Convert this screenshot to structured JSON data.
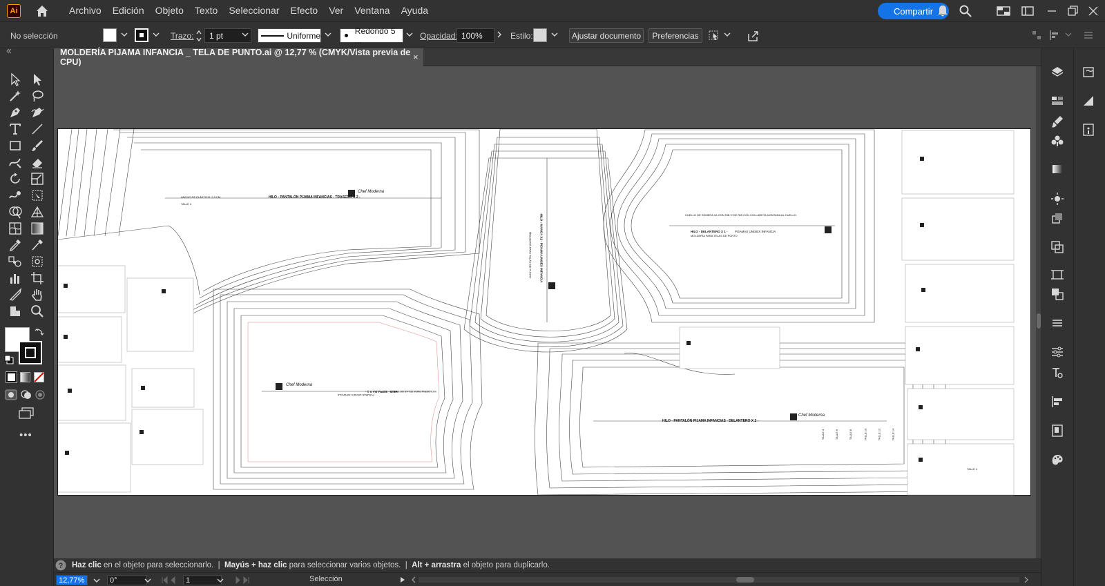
{
  "app": {
    "logo_text": "Ai",
    "menu": [
      "Archivo",
      "Edición",
      "Objeto",
      "Texto",
      "Seleccionar",
      "Efecto",
      "Ver",
      "Ventana",
      "Ayuda"
    ],
    "share_label": "Compartir",
    "accent": "#1473e6"
  },
  "control": {
    "selection_status": "No selección",
    "stroke_label": "Trazo:",
    "stroke_weight": "1 pt",
    "stroke_profile": "Uniforme",
    "brush": "Redondo 5 ...",
    "opacity_label": "Opacidad:",
    "opacity_value": "100%",
    "style_label": "Estilo:",
    "fit_document_label": "Ajustar documento",
    "preferences_label": "Preferencias"
  },
  "document": {
    "tab_title": "MOLDERÍA PIJAMA INFANCIA _ TELA DE PUNTO.ai @ 12,77 % (CMYK/Vista previa de CPU)",
    "close_glyph": "×"
  },
  "pattern": {
    "back_pants": "HILO - PANTALÓN PIJAMA INFANCIAS - TRASERO X 2 -",
    "elastic": "ANCHO DE ELÁSTICO: 2,5 CM",
    "sleeve": "HILO - MANGA X2 - PIJAMA UNISEX INFANCIA",
    "sleeve_sub": "MOLDERÍA PARA TELAS DE PUNTO",
    "front": "HILO - DELANTERO X 1 -",
    "front_sub": "PIJAMAS UNISEX INFANCIA",
    "front_sub2": "MOLDERÍA PARA TELAS DE PUNTO",
    "neck_note": "CUELLO DE REMERA VA CON RIB O DE RIB CON COLLARETA MONTADA AL CUELLO.",
    "back": "HILO - ESPALDA X 1 -",
    "back_sub": "PIJAMAS UNISEX INFANCIA",
    "back_sub2": "MOLDERÍA PARA TELAS DE PUNTO",
    "front_pants": "HILO - PANTALÓN PIJAMA INFANCIAS - DELANTERO X 2 -",
    "sizes": [
      "TALLE 4",
      "TALLE 6",
      "TALLE 8",
      "TALLE 10",
      "TALLE 12",
      "TALLE 14"
    ],
    "brand": "Chef Moderna"
  },
  "hint": {
    "part1_bold": "Haz clic",
    "part1": " en el objeto para seleccionarlo.  |  ",
    "part2_bold": "Mayús + haz clic",
    "part2": " para seleccionar varios objetos.  |  ",
    "part3_bold": "Alt + arrastra",
    "part3": " el objeto para duplicarlo."
  },
  "status": {
    "zoom": "12,77%",
    "rotation": "0°",
    "artboard_number": "1",
    "tool_name": "Selección"
  }
}
